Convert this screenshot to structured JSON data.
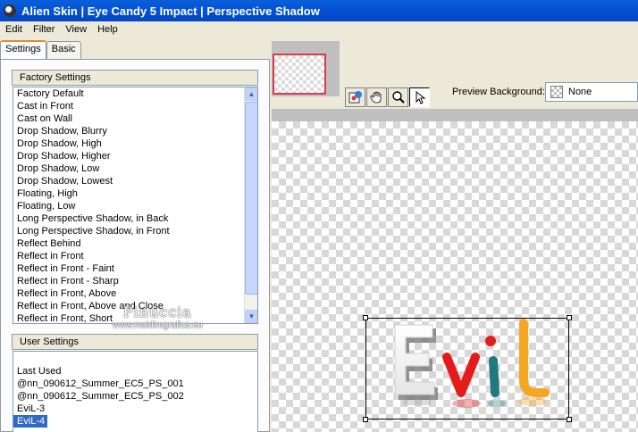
{
  "window": {
    "title": "Alien Skin | Eye Candy 5 Impact | Perspective Shadow"
  },
  "menu": [
    "Edit",
    "Filter",
    "View",
    "Help"
  ],
  "tabs": [
    "Settings",
    "Basic"
  ],
  "factory": {
    "header": "Factory Settings",
    "items": [
      "Factory Default",
      "Cast in Front",
      "Cast on Wall",
      "Drop Shadow, Blurry",
      "Drop Shadow, High",
      "Drop Shadow, Higher",
      "Drop Shadow, Low",
      "Drop Shadow, Lowest",
      "Floating, High",
      "Floating, Low",
      "Long Perspective Shadow, in Back",
      "Long Perspective Shadow, in Front",
      "Reflect Behind",
      "Reflect in Front",
      "Reflect in Front - Faint",
      "Reflect in Front - Sharp",
      "Reflect in Front, Above",
      "Reflect in Front, Above and Close",
      "Reflect in Front, Short"
    ]
  },
  "user": {
    "header": "User Settings",
    "items": [
      "Last Used",
      "@nn_090612_Summer_EC5_PS_001",
      "@nn_090612_Summer_EC5_PS_002",
      "EviL-3",
      "EviL-4"
    ],
    "selected": "EviL-4"
  },
  "preview": {
    "background_label": "Preview Background:",
    "background_value": "None",
    "word": [
      "E",
      "v",
      "i",
      "L"
    ],
    "letter_colors": [
      "#f4f4f4",
      "#e51b1b",
      "#1f7a80",
      "#f5a623"
    ]
  },
  "icons": {
    "tools": [
      "preview-background-icon",
      "hand-pan-icon",
      "zoom-icon",
      "pointer-icon"
    ],
    "scroll_up": "▲",
    "scroll_down": "▼"
  },
  "watermark": {
    "name": "Pinuccia",
    "site": "www.maidiregrafica.eu"
  }
}
